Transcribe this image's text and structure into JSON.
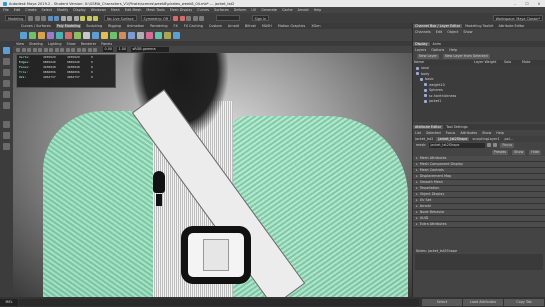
{
  "window": {
    "title": "Autodesk Maya 2019.2 - Student Version: X:\\GSMA_Characters_V1\\Pirate\\scenes\\week8\\pirates_week8_04.mb* --- jacket_tst2",
    "minimize": "–",
    "maximize": "☐",
    "close": "✕"
  },
  "menubar": [
    "File",
    "Edit",
    "Create",
    "Select",
    "Modify",
    "Display",
    "Windows",
    "Mesh",
    "Edit Mesh",
    "Mesh Tools",
    "Mesh Display",
    "Curves",
    "Surfaces",
    "Deform",
    "UV",
    "Generate",
    "Cache",
    "Arnold",
    "Help"
  ],
  "statusline": {
    "mode": "Modeling",
    "symmetry": "No Live Surface",
    "symmetry_axis": "Symmetry: Off",
    "search_placeholder": "",
    "signin": "Sign In",
    "workspace": "Workspace: Maya Classic*"
  },
  "shelf_tabs": [
    {
      "label": "Curves / Surfaces",
      "active": false
    },
    {
      "label": "Poly Modeling",
      "active": true
    },
    {
      "label": "Sculpting",
      "active": false
    },
    {
      "label": "Rigging",
      "active": false
    },
    {
      "label": "Animation",
      "active": false
    },
    {
      "label": "Rendering",
      "active": false
    },
    {
      "label": "FX",
      "active": false
    },
    {
      "label": "FX Caching",
      "active": false
    },
    {
      "label": "Custom",
      "active": false
    },
    {
      "label": "Arnold",
      "active": false
    },
    {
      "label": "Bifrost",
      "active": false
    },
    {
      "label": "MASH",
      "active": false
    },
    {
      "label": "Motion Graphics",
      "active": false
    },
    {
      "label": "XGen",
      "active": false
    }
  ],
  "shelf_icon_colors": [
    "#5aa0d8",
    "#6cc36a",
    "#d8a24a",
    "#9a7bd0",
    "#49b3b3",
    "#d86a6a",
    "#8fbf5a",
    "#c8c8c8",
    "#5aa0d8",
    "#e0c050",
    "#6cc36a",
    "#d88a5a",
    "#7a9ad8",
    "#b0b0b0",
    "#d86a9a",
    "#5ac8a8",
    "#a8a850",
    "#5aa0d8"
  ],
  "viewport": {
    "menu": [
      "View",
      "Shading",
      "Lighting",
      "Show",
      "Renderer",
      "Panels"
    ],
    "camera_field": "sRGB gamma",
    "exposure": "0.00",
    "gamma": "1.00"
  },
  "poly_count": {
    "headers": [
      "",
      "",
      "",
      ""
    ],
    "rows": [
      [
        "Verts:",
        "4935629",
        "4935629",
        "0"
      ],
      [
        "Edges:",
        "9865640",
        "9865640",
        "0"
      ],
      [
        "Faces:",
        "4930048",
        "4930048",
        "0"
      ],
      [
        "Tris:",
        "9860096",
        "9860096",
        "0"
      ],
      [
        "UVs:",
        "4962737",
        "4962737",
        "0"
      ]
    ]
  },
  "channel_box_tabs": [
    {
      "label": "Channel Box / Layer Editor",
      "active": true
    },
    {
      "label": "Modelling Toolkit",
      "active": false
    },
    {
      "label": "Attribute Editor",
      "active": false
    }
  ],
  "channel_box_menu": [
    "Channels",
    "Edit",
    "Object",
    "Show"
  ],
  "layers": {
    "tabs": [
      {
        "label": "Display",
        "active": true
      },
      {
        "label": "Anim",
        "active": false
      }
    ],
    "menu": [
      "Layers",
      "Options",
      "Help"
    ],
    "buttons": [
      "New Layer",
      "New Layer from Selected"
    ],
    "columns": [
      "Name",
      "Layer Weight",
      "Solo",
      "Mute"
    ],
    "rows": [
      {
        "name": "lanai",
        "indent": 0
      },
      {
        "name": "body",
        "indent": 0
      },
      {
        "name": "basic",
        "indent": 1
      },
      {
        "name": "weight10",
        "indent": 2
      },
      {
        "name": "Spheres",
        "indent": 2
      },
      {
        "name": "sc.hairthickness",
        "indent": 2
      },
      {
        "name": "jacket1",
        "indent": 2
      }
    ]
  },
  "attribute_editor": {
    "title_tabs": [
      {
        "label": "Attribute Editor",
        "active": true
      },
      {
        "label": "Tool Settings",
        "active": false
      }
    ],
    "menu": [
      "List",
      "Selected",
      "Focus",
      "Attributes",
      "Show",
      "Help"
    ],
    "node_tabs": [
      {
        "label": "jacket_tst2",
        "active": false
      },
      {
        "label": "jacket_tst2Shape",
        "active": true
      },
      {
        "label": "sculptingLayer1",
        "active": false
      },
      {
        "label": "pol...",
        "active": false
      }
    ],
    "mesh_label": "mesh:",
    "mesh_value": "jacket_tst2Shape",
    "focus_btn": "Focus",
    "presets_btn": "Presets",
    "show_btn": "Show",
    "hide_btn": "Hide",
    "sections": [
      "Mesh Attributes",
      "Mesh Component Display",
      "Mesh Controls",
      "Displacement Map",
      "Smooth Mesh",
      "Tessellation",
      "Object Display",
      "UV Set",
      "Arnold",
      "Node Behavior",
      "UUID",
      "Extra Attributes"
    ],
    "notes_label": "Notes: jacket_tst2Shape",
    "bottom_buttons": [
      "Select",
      "Load Attributes",
      "Copy Tab"
    ]
  },
  "bottom_bar": {
    "mel": "MEL",
    "command": ""
  }
}
